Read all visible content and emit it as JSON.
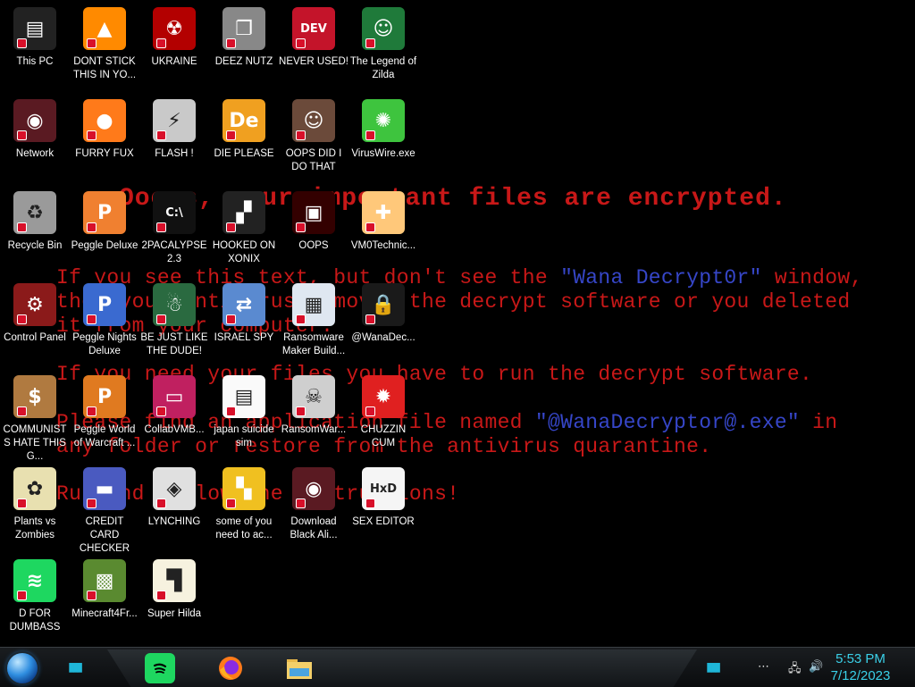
{
  "wallpaper": {
    "title": "Ooops, your important files are encrypted.",
    "line1_pre": "If you see this text, but don't see the ",
    "line1_highlight": "\"Wana Decrypt0r\"",
    "line1_post": " window,",
    "line2": "then your antivirus removed the decrypt software or you deleted",
    "line3": "it from your computer.",
    "line4": "If you need your files you have to run the decrypt software.",
    "line5_pre": "Please find an application file named ",
    "line5_highlight": "\"@WanaDecryptor@.exe\"",
    "line5_post": " in",
    "line6": "any folder or restore from the antivirus quarantine.",
    "line7": "Run and follow the instructions!"
  },
  "icons": [
    {
      "label": "This PC",
      "icon": "computer-icon"
    },
    {
      "label": "DONT STICK THIS IN YO...",
      "icon": "vlc-cone-icon"
    },
    {
      "label": "UKRAINE",
      "icon": "radiation-icon"
    },
    {
      "label": "DEEZ NUTZ",
      "icon": "stacked-windows-icon"
    },
    {
      "label": "NEVER USED!",
      "icon": "dev-cpp-icon"
    },
    {
      "label": "The Legend of Zilda",
      "icon": "pixel-character-icon"
    },
    {
      "label": "Network",
      "icon": "network-globe-icon"
    },
    {
      "label": "FURRY FUX",
      "icon": "firefox-icon"
    },
    {
      "label": "FLASH !",
      "icon": "flash-icon"
    },
    {
      "label": "DIE PLEASE",
      "icon": "die-icon"
    },
    {
      "label": "OOPS DID I DO THAT",
      "icon": "portrait-icon"
    },
    {
      "label": "VirusWire.exe",
      "icon": "lime-icon"
    },
    {
      "label": "Recycle Bin",
      "icon": "recycle-bin-icon"
    },
    {
      "label": "Peggle Deluxe",
      "icon": "peggle-icon"
    },
    {
      "label": "2PACALYPSE 2.3",
      "icon": "terminal-icon"
    },
    {
      "label": "HOOKED ON XONIX",
      "icon": "xonix-icon"
    },
    {
      "label": "OOPS",
      "icon": "dark-app-icon"
    },
    {
      "label": "VM0Technic...",
      "icon": "doctor-icon"
    },
    {
      "label": "Control Panel",
      "icon": "control-panel-icon"
    },
    {
      "label": "Peggle Nights Deluxe",
      "icon": "peggle-nights-icon"
    },
    {
      "label": "BE JUST LIKE THE DUDE!",
      "icon": "santa-icon"
    },
    {
      "label": "ISRAEL SPY",
      "icon": "network-spy-icon"
    },
    {
      "label": "Ransomware Maker Build...",
      "icon": "window-app-icon"
    },
    {
      "label": "@WanaDec...",
      "icon": "wanadecryptor-icon"
    },
    {
      "label": "COMMUNISTS HATE THIS G...",
      "icon": "money-bag-icon"
    },
    {
      "label": "Peggle World of Warcraft ...",
      "icon": "peggle-wow-icon"
    },
    {
      "label": "CollabVMB...",
      "icon": "monitor-icon"
    },
    {
      "label": "japan suicide sim",
      "icon": "document-icon"
    },
    {
      "label": "RansomWar...",
      "icon": "skull-icon"
    },
    {
      "label": "CHUZZIN CUM",
      "icon": "chuzzle-icon"
    },
    {
      "label": "Plants vs Zombies",
      "icon": "flower-icon"
    },
    {
      "label": "CREDIT CARD CHECKER",
      "icon": "credit-card-icon"
    },
    {
      "label": "LYNCHING",
      "icon": "shield-icon"
    },
    {
      "label": "some of you need to ac...",
      "icon": "pixel-dog-icon"
    },
    {
      "label": "Download Black Ali...",
      "icon": "orb-icon"
    },
    {
      "label": "SEX EDITOR",
      "icon": "hxd-icon"
    },
    {
      "label": "D FOR DUMBASS",
      "icon": "spotify-icon"
    },
    {
      "label": "Minecraft4Fr...",
      "icon": "grass-block-icon"
    },
    {
      "label": "Super Hilda",
      "icon": "pixel-cat-icon"
    }
  ],
  "taskbar": {
    "apps": [
      {
        "name": "spotify",
        "icon": "spotify-icon"
      },
      {
        "name": "firefox",
        "icon": "firefox-icon"
      },
      {
        "name": "file-explorer",
        "icon": "folder-icon"
      }
    ],
    "time": "5:53 PM",
    "date": "7/12/2023",
    "accent": "#3ad0e8"
  }
}
